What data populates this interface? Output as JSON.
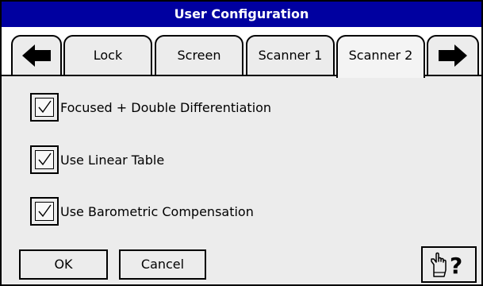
{
  "window": {
    "title": "User Configuration"
  },
  "tabs": {
    "prev_icon": "arrow-left-icon",
    "next_icon": "arrow-right-icon",
    "items": [
      {
        "label": "Lock"
      },
      {
        "label": "Screen"
      },
      {
        "label": "Scanner 1"
      },
      {
        "label": "Scanner 2",
        "active": true
      }
    ]
  },
  "options": [
    {
      "label": "Focused + Double Differentiation",
      "checked": true
    },
    {
      "label": "Use Linear Table",
      "checked": true
    },
    {
      "label": "Use Barometric Compensation",
      "checked": true
    }
  ],
  "buttons": {
    "ok_label": "OK",
    "cancel_label": "Cancel",
    "help_icon": "hand-question-help-icon"
  },
  "colors": {
    "title_bar": "#0000a0",
    "title_text": "#ffffff",
    "panel": "#ececec"
  }
}
